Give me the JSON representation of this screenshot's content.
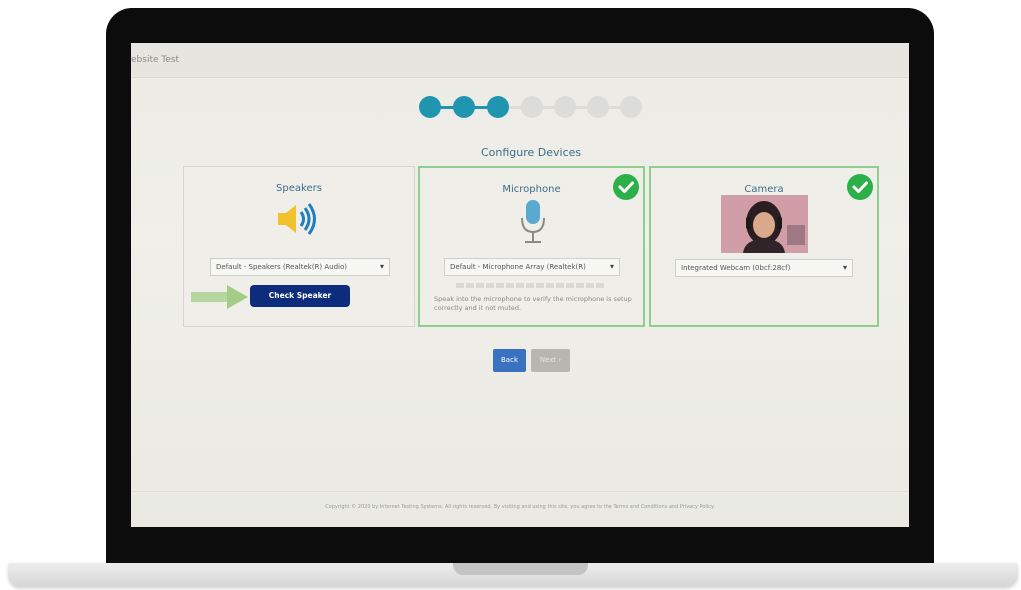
{
  "screen": {
    "site_title": "ebsite Test",
    "section_title": "Configure Devices",
    "stepper": {
      "completed_steps": 3,
      "total_steps": 7
    }
  },
  "speakers": {
    "title": "Speakers",
    "selected_device": "Default - Speakers (Realtek(R) Audio)",
    "check_button": "Check Speaker",
    "icon": "speaker-icon"
  },
  "microphone": {
    "title": "Microphone",
    "selected_device": "Default - Microphone Array (Realtek(R)",
    "hint": "Speak into the microphone to verify the microphone is setup correctly and it not muted.",
    "icon": "microphone-icon",
    "status": "ok"
  },
  "camera": {
    "title": "Camera",
    "selected_device": "Integrated Webcam (0bcf:28cf)",
    "status": "ok"
  },
  "nav": {
    "back": "Back",
    "next": "Next ›"
  },
  "footer": "Copyright © 2020 by Internet Testing Systems. All rights reserved. By visiting and using this site, you agree to the Terms and Conditions and Privacy Policy.",
  "colors": {
    "step_done": "#1f95b0",
    "step_todo": "#dcdcd8",
    "ok_green": "#2bb04a",
    "primary_dark": "#0d2d7c",
    "primary_blue": "#3a72c0"
  }
}
